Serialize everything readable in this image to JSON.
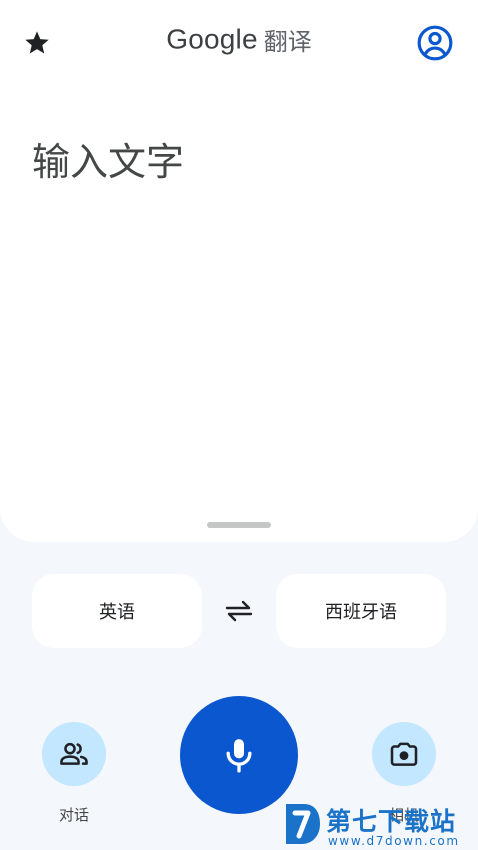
{
  "header": {
    "brand": "Google",
    "title_suffix": "翻译",
    "favorites_icon": "star-icon",
    "account_icon": "account-circle-icon"
  },
  "input": {
    "placeholder": "输入文字",
    "value": ""
  },
  "languages": {
    "source": "英语",
    "target": "西班牙语",
    "swap_icon": "swap-arrows-icon"
  },
  "actions": {
    "conversation_label": "对话",
    "conversation_icon": "people-icon",
    "mic_icon": "microphone-icon",
    "camera_label": "相机",
    "camera_icon": "camera-icon"
  },
  "watermark": {
    "text": "第七下载站",
    "url": "www.d7down.com"
  },
  "colors": {
    "accent": "#0b57d0",
    "accent_light": "#c2e7ff",
    "background": "#f4f7fc",
    "card": "#ffffff",
    "watermark": "#1a73c8"
  }
}
